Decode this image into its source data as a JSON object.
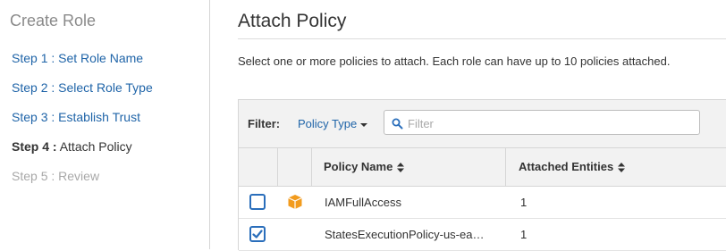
{
  "sidebar": {
    "title": "Create Role",
    "steps": [
      {
        "label": "Step 1 : Set Role Name",
        "state": "link"
      },
      {
        "label": "Step 2 : Select Role Type",
        "state": "link"
      },
      {
        "label": "Step 3 : Establish Trust",
        "state": "link"
      },
      {
        "prefix": "Step 4 :",
        "label": "Attach Policy",
        "state": "current"
      },
      {
        "label": "Step 5 : Review",
        "state": "disabled"
      }
    ]
  },
  "main": {
    "title": "Attach Policy",
    "intro": "Select one or more policies to attach. Each role can have up to 10 policies attached.",
    "filter": {
      "label": "Filter:",
      "dropdown_label": "Policy Type",
      "placeholder": "Filter",
      "value": ""
    },
    "table": {
      "columns": [
        "Policy Name",
        "Attached Entities"
      ],
      "rows": [
        {
          "checked": false,
          "icon": "aws-managed-box-icon",
          "name": "IAMFullAccess",
          "attached": "1"
        },
        {
          "checked": true,
          "icon": "",
          "name": "StatesExecutionPolicy-us-ea…",
          "attached": "1"
        }
      ]
    }
  },
  "colors": {
    "link": "#1f64a8",
    "checkbox_border": "#2a6ebb",
    "aws_orange": "#f29b1d",
    "header_bg": "#f2f2f2"
  }
}
